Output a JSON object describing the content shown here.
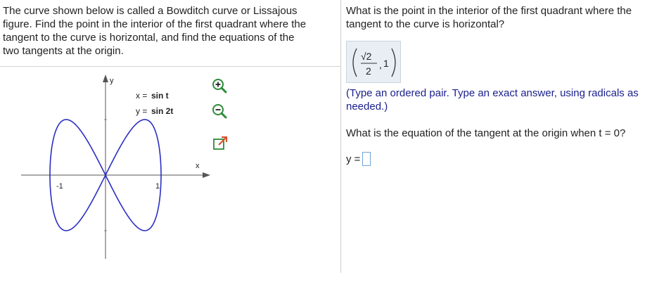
{
  "problem": {
    "lines": [
      "The curve shown below is called a Bowditch curve or Lissajous",
      "figure. Find the point in the interior of the first quadrant where the",
      "tangent to the curve is horizontal, and find the equations of the",
      "two tangents at the origin."
    ]
  },
  "graph": {
    "eq_x_lhs": "x =",
    "eq_x_rhs": "sin t",
    "eq_y_lhs": "y =",
    "eq_y_rhs": "sin 2t",
    "y_axis_label": "y",
    "x_axis_label": "x",
    "tick_neg": "-1",
    "tick_pos": "1",
    "curve_color": "#2b2fc2",
    "axis_color": "#555555"
  },
  "tools": [
    {
      "name": "zoom-in-icon"
    },
    {
      "name": "zoom-out-icon"
    },
    {
      "name": "popout-icon"
    }
  ],
  "right": {
    "q1_lines": [
      "What is the point in the interior of the first quadrant where the",
      "tangent to the curve is horizontal?"
    ],
    "answer1": {
      "numerator": "√2",
      "denominator": "2",
      "separator": ",",
      "second": "1"
    },
    "hint_lines": [
      "(Type an ordered pair. Type an exact answer, using radicals as",
      "needed.)"
    ],
    "q2": "What is the equation of the tangent at the origin when t = 0?",
    "tangent_label": "y =",
    "tangent_value": ""
  }
}
